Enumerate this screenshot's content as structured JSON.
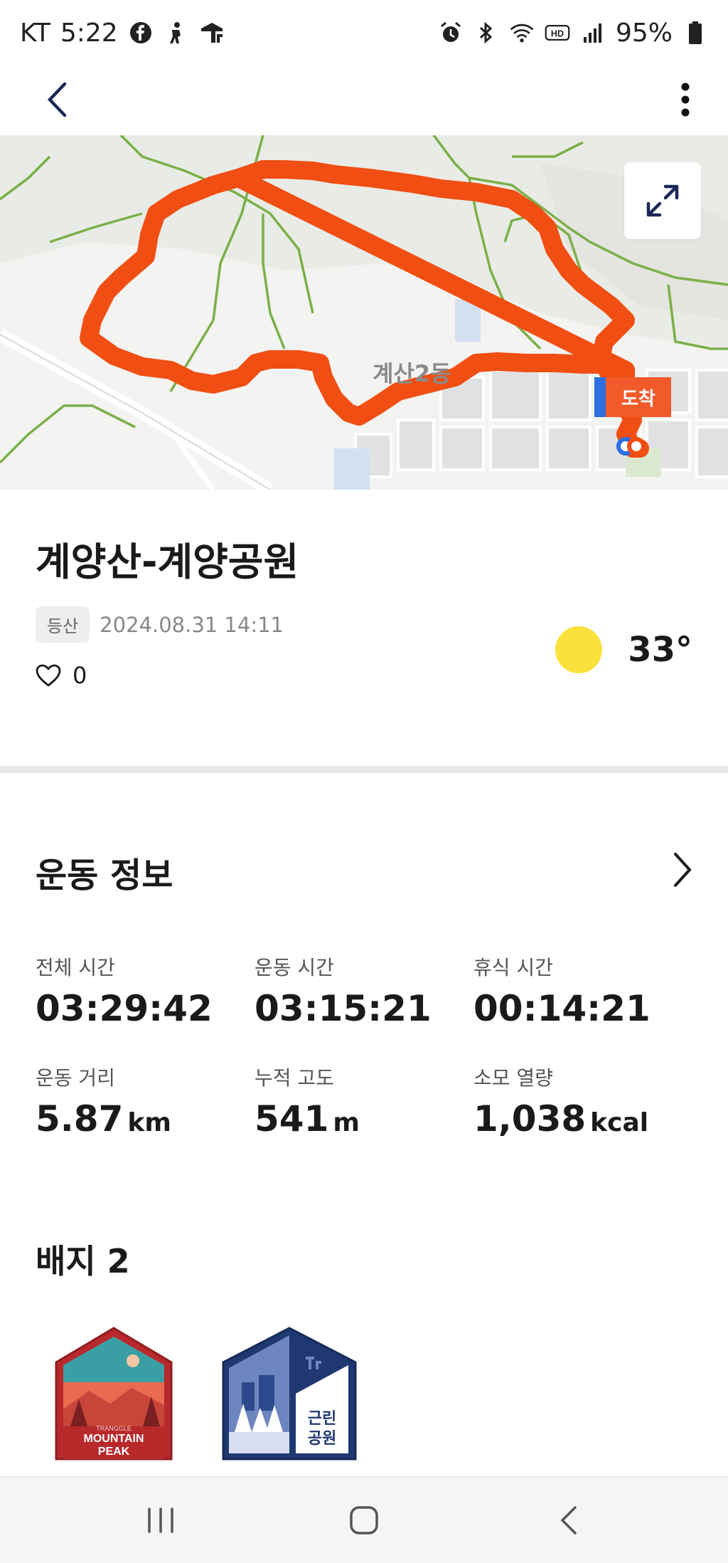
{
  "status_bar": {
    "carrier": "KT",
    "time": "5:22",
    "battery": "95%"
  },
  "map": {
    "area_label": "계산2동",
    "arrival_label": "도착"
  },
  "activity": {
    "title": "계양산-계양공원",
    "category": "등산",
    "datetime": "2024.08.31 14:11",
    "likes": "0",
    "temperature": "33°"
  },
  "exercise_info": {
    "heading": "운동 정보",
    "stats": [
      {
        "label": "전체 시간",
        "value": "03:29:42",
        "unit": ""
      },
      {
        "label": "운동 시간",
        "value": "03:15:21",
        "unit": ""
      },
      {
        "label": "휴식 시간",
        "value": "00:14:21",
        "unit": ""
      },
      {
        "label": "운동 거리",
        "value": "5.87",
        "unit": "km"
      },
      {
        "label": "누적 고도",
        "value": "541",
        "unit": "m"
      },
      {
        "label": "소모 열량",
        "value": "1,038",
        "unit": "kcal"
      }
    ]
  },
  "badges": {
    "heading": "배지 2",
    "items": [
      {
        "line1": "TRANGGLE",
        "line2": "MOUNTAIN",
        "line3": "PEAK"
      },
      {
        "line1": "근린",
        "line2": "공원"
      }
    ]
  },
  "colors": {
    "route": "#f04e12",
    "arrival_tag": "#f25a2a",
    "start_marker": "#2d6fe0",
    "sun": "#fbe13b"
  }
}
